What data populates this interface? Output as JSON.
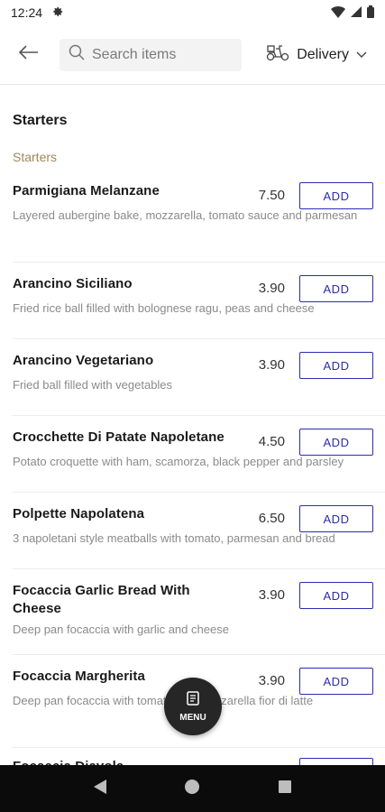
{
  "status_bar": {
    "time": "12:24"
  },
  "header": {
    "search_placeholder": "Search items",
    "delivery_label": "Delivery"
  },
  "menu": {
    "section_title": "Starters",
    "subsection_title": "Starters",
    "add_label": "ADD",
    "items": [
      {
        "name": "Parmigiana Melanzane",
        "price": "7.50",
        "description": "Layered aubergine bake, mozzarella, tomato sauce and parmesan"
      },
      {
        "name": "Arancino Siciliano",
        "price": "3.90",
        "description": "Fried rice ball filled with bolognese ragu, peas and cheese"
      },
      {
        "name": "Arancino Vegetariano",
        "price": "3.90",
        "description": "Fried ball filled with vegetables"
      },
      {
        "name": "Crocchette Di Patate Napoletane",
        "price": "4.50",
        "description": "Potato croquette with ham, scamorza, black pepper and parsley"
      },
      {
        "name": "Polpette Napolatena",
        "price": "6.50",
        "description": "3 napoletani style meatballs with tomato, parmesan and bread"
      },
      {
        "name": "Focaccia Garlic Bread With Cheese",
        "price": "3.90",
        "description": "Deep pan focaccia with garlic and cheese"
      },
      {
        "name": "Focaccia Margherita",
        "price": "3.90",
        "description": "Deep pan focaccia with tomato and mozzarella fior di latte"
      },
      {
        "name": "Focaccia Diavola",
        "price": "",
        "description": ""
      }
    ]
  },
  "fab": {
    "label": "MENU"
  },
  "colors": {
    "accent": "#2c2cb0",
    "subsection": "#a0875b",
    "fab_bg": "#262626"
  }
}
